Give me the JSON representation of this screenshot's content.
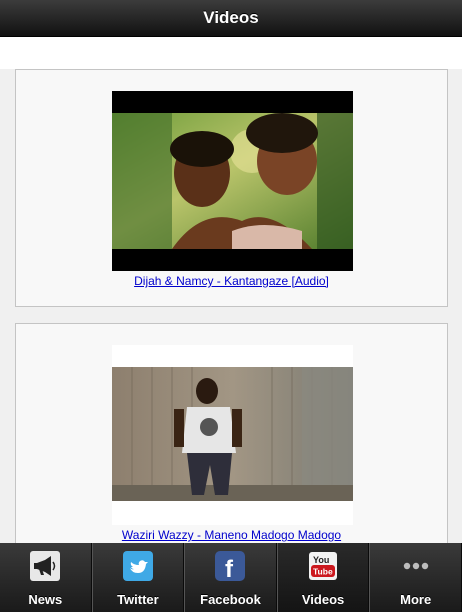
{
  "header": {
    "title": "Videos"
  },
  "videos": [
    {
      "title": "Dijah & Namcy - Kantangaze [Audio]"
    },
    {
      "title": "Waziri Wazzy - Maneno Madogo Madogo"
    }
  ],
  "tabbar": {
    "tabs": [
      {
        "label": "News",
        "icon": "megaphone-icon"
      },
      {
        "label": "Twitter",
        "icon": "twitter-bird-icon"
      },
      {
        "label": "Facebook",
        "icon": "facebook-icon"
      },
      {
        "label": "Videos",
        "icon": "youtube-icon"
      },
      {
        "label": "More",
        "icon": "more-dots-icon"
      }
    ],
    "active": "Videos"
  },
  "colors": {
    "link": "#0000cc",
    "bar": "#1a1a1a",
    "youtube_red": "#cc181e",
    "facebook_blue": "#3b5998",
    "twitter_blue": "#3fa9e6"
  }
}
